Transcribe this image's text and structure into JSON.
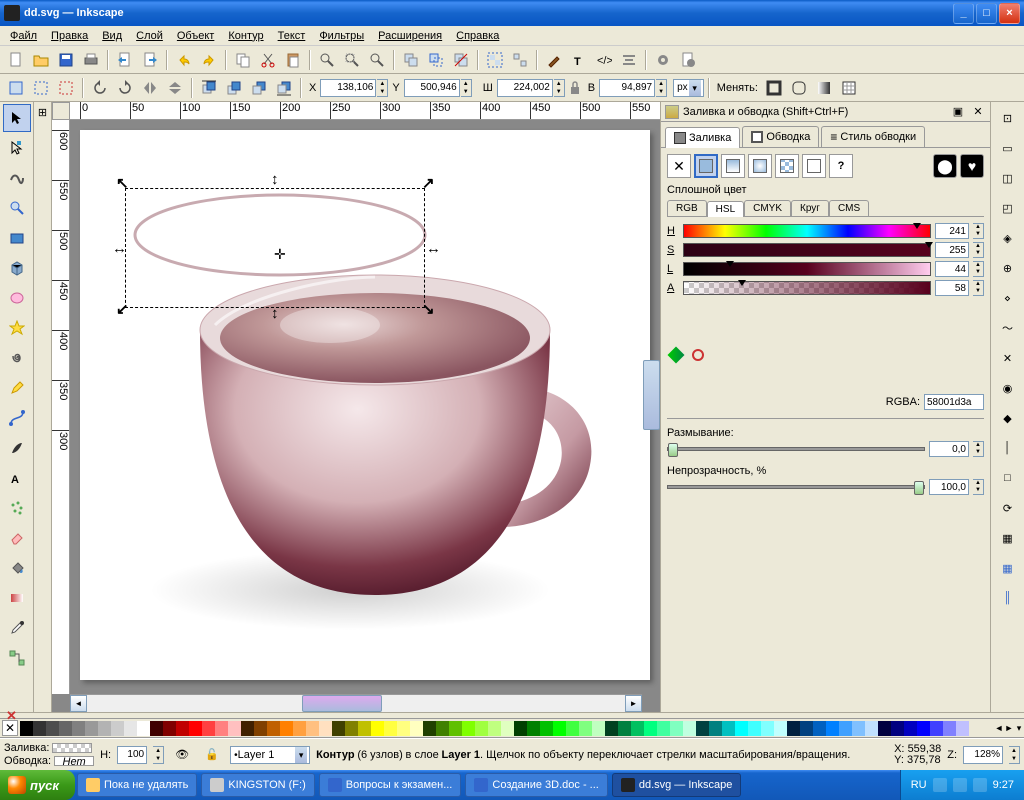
{
  "window": {
    "title": "dd.svg — Inkscape"
  },
  "menu": [
    "Файл",
    "Правка",
    "Вид",
    "Слой",
    "Объект",
    "Контур",
    "Текст",
    "Фильтры",
    "Расширения",
    "Справка"
  ],
  "toolbar2": {
    "x_label": "X",
    "x": "138,106",
    "y_label": "Y",
    "y": "500,946",
    "w_label": "Ш",
    "w": "224,002",
    "h_label": "В",
    "h": "94,897",
    "units": "px",
    "change_label": "Менять:"
  },
  "ruler_h": [
    "0",
    "50",
    "100",
    "150",
    "200",
    "250",
    "300",
    "350",
    "400",
    "450",
    "500",
    "550"
  ],
  "ruler_v": [
    "600",
    "550",
    "500",
    "450",
    "400",
    "350",
    "300"
  ],
  "panel": {
    "title": "Заливка и обводка (Shift+Ctrl+F)",
    "tabs": {
      "fill": "Заливка",
      "stroke": "Обводка",
      "style": "Стиль обводки"
    },
    "flat_label": "Сплошной цвет",
    "color_tabs": [
      "RGB",
      "HSL",
      "CMYK",
      "Круг",
      "CMS"
    ],
    "hsl": {
      "h_label": "H",
      "h": "241",
      "s_label": "S",
      "s": "255",
      "l_label": "L",
      "l": "44",
      "a_label": "A",
      "a": "58"
    },
    "rgba_label": "RGBA:",
    "rgba": "58001d3a",
    "blur_label": "Размывание:",
    "blur": "0,0",
    "opacity_label": "Непрозрачность, %",
    "opacity": "100,0"
  },
  "palette": [
    "#000",
    "#333",
    "#4d4d4d",
    "#666",
    "#808080",
    "#999",
    "#b3b3b3",
    "#ccc",
    "#e6e6e6",
    "#fff",
    "#400000",
    "#800000",
    "#c00000",
    "#ff0000",
    "#ff4040",
    "#ff8080",
    "#ffc0c0",
    "#402000",
    "#804000",
    "#c06000",
    "#ff8000",
    "#ffa040",
    "#ffc080",
    "#ffe0c0",
    "#404000",
    "#808000",
    "#c0c000",
    "#ffff00",
    "#ffff40",
    "#ffff80",
    "#ffffc0",
    "#204000",
    "#408000",
    "#60c000",
    "#80ff00",
    "#a0ff40",
    "#c0ff80",
    "#e0ffc0",
    "#004000",
    "#008000",
    "#00c000",
    "#00ff00",
    "#40ff40",
    "#80ff80",
    "#c0ffc0",
    "#004020",
    "#008040",
    "#00c060",
    "#00ff80",
    "#40ffa0",
    "#80ffc0",
    "#c0ffe0",
    "#004040",
    "#008080",
    "#00c0c0",
    "#00ffff",
    "#40ffff",
    "#80ffff",
    "#c0ffff",
    "#002040",
    "#004080",
    "#0060c0",
    "#0080ff",
    "#40a0ff",
    "#80c0ff",
    "#c0e0ff",
    "#000040",
    "#000080",
    "#0000c0",
    "#0000ff",
    "#4040ff",
    "#8080ff",
    "#c0c0ff"
  ],
  "status": {
    "fill_label": "Заливка:",
    "stroke_label": "Обводка:",
    "stroke_val": "Нет",
    "sw_label": "Н:",
    "sw_val": "100",
    "layer": "Layer 1",
    "msg_prefix": "Контур",
    "msg_nodes": "(6 узлов)",
    "msg_mid": "в слое",
    "msg_layer": "Layer 1",
    "msg_tail": ". Щелчок по объекту переключает стрелки масштабирования/вращения.",
    "x_label": "X:",
    "x": "559,38",
    "y_label": "Y:",
    "y": "375,78",
    "z_label": "Z:",
    "z": "128%"
  },
  "taskbar": {
    "start": "пуск",
    "items": [
      "Пока не удалять",
      "KINGSTON (F:)",
      "Вопросы к экзамен...",
      "Создание 3D.doc - ...",
      "dd.svg — Inkscape"
    ],
    "lang": "RU",
    "time": "9:27"
  }
}
